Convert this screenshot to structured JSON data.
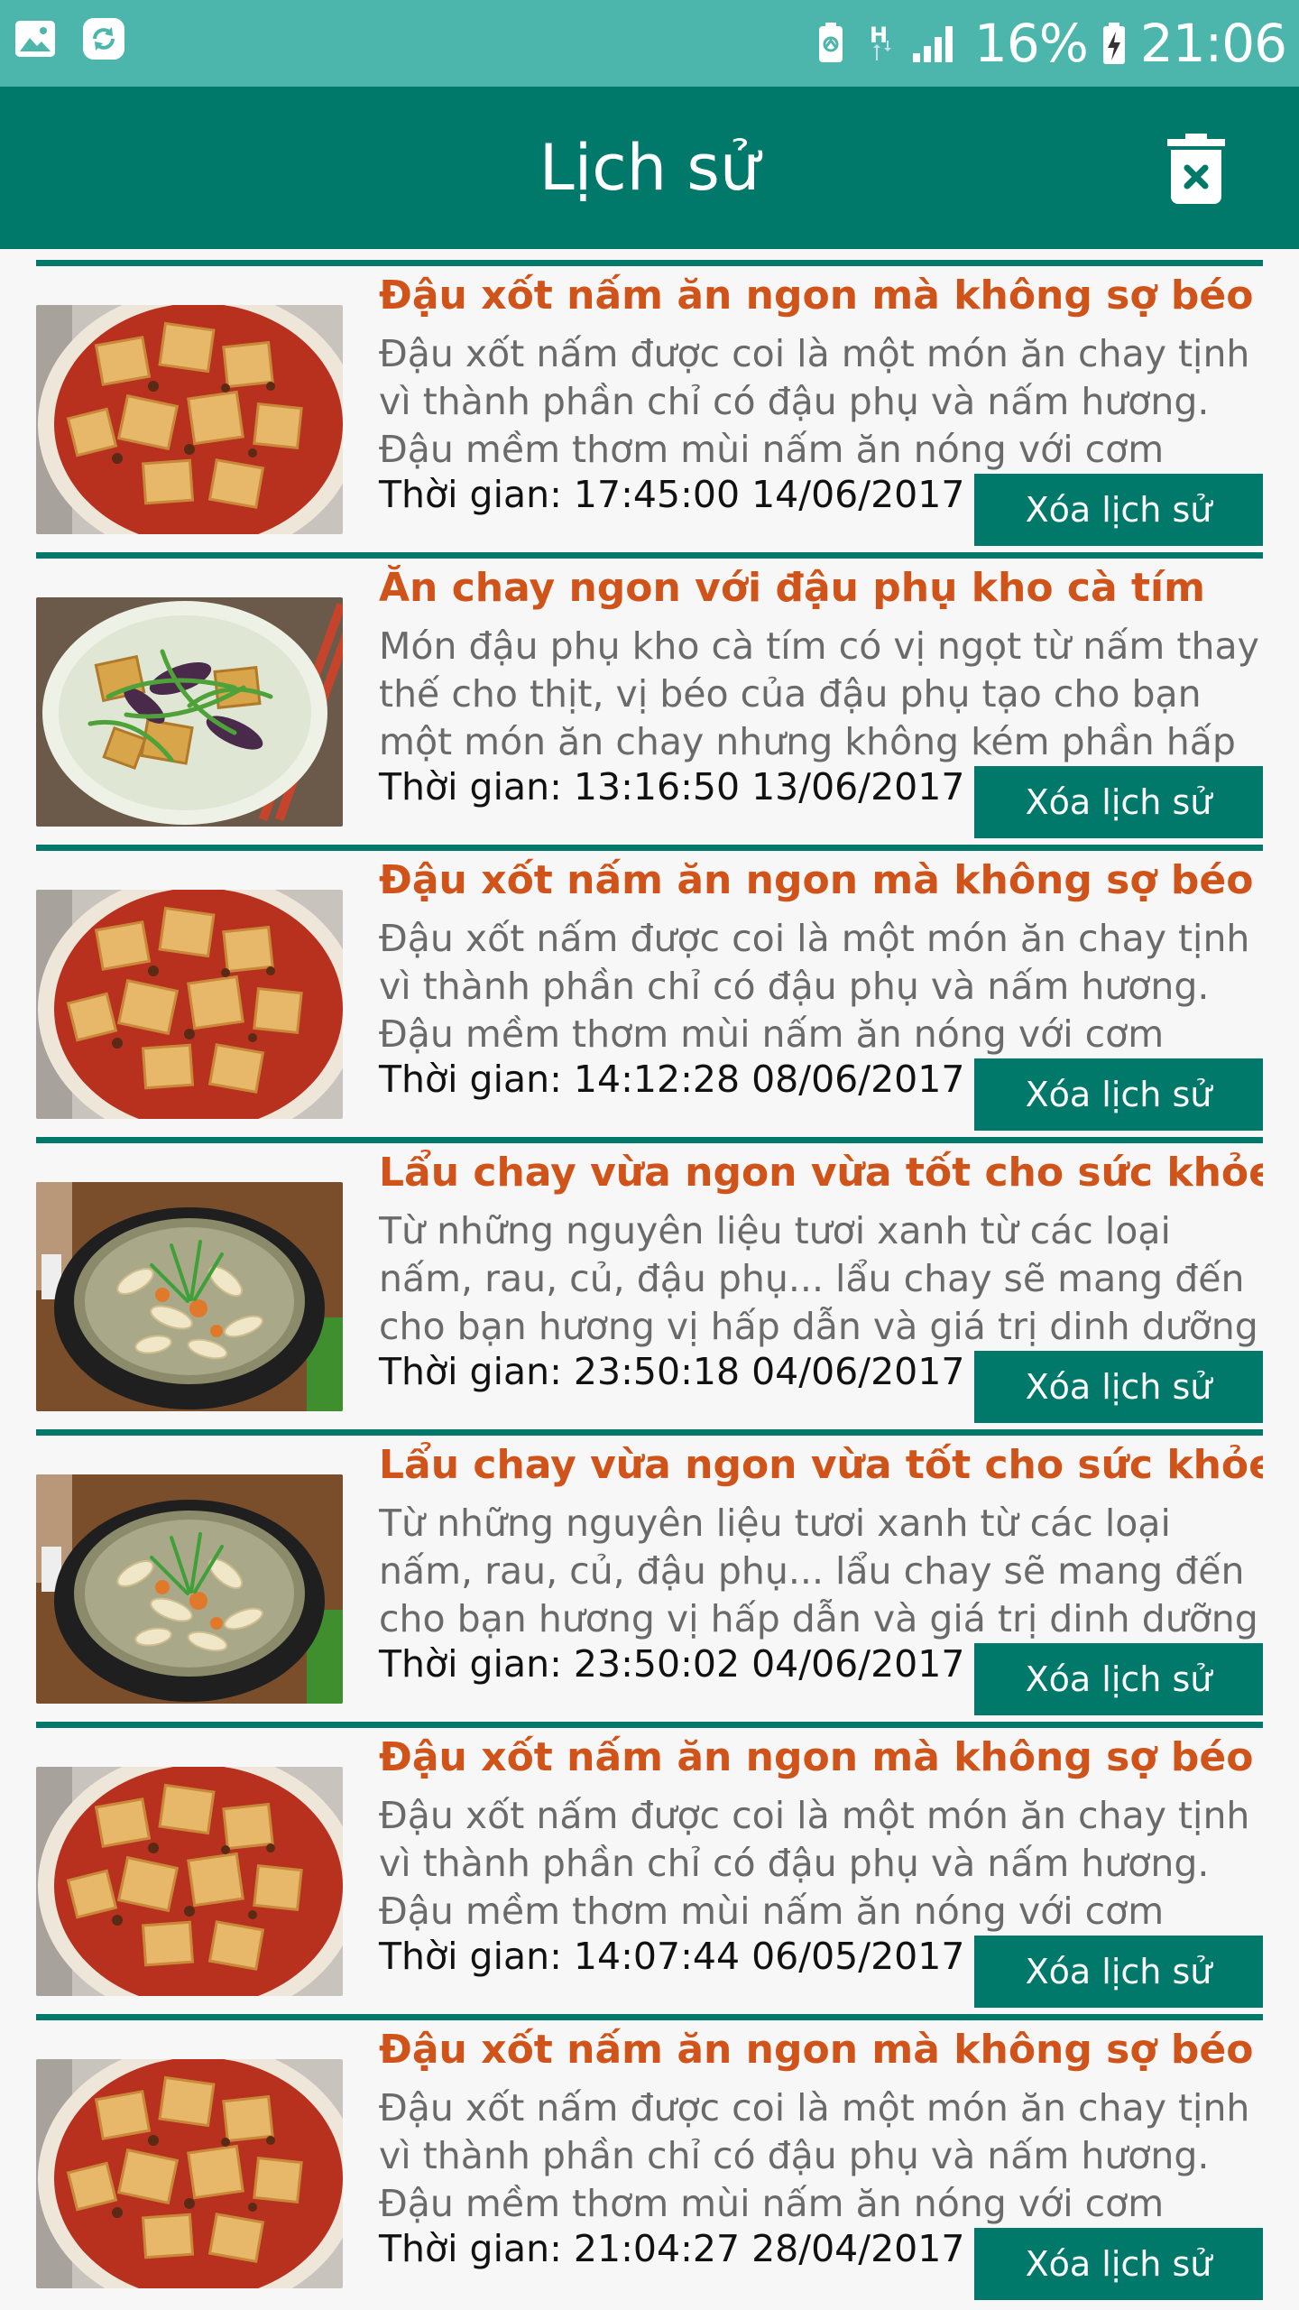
{
  "status_bar": {
    "battery": "16%",
    "time": "21:06",
    "icons": [
      "gallery-icon",
      "sync-icon",
      "battery-saver-icon",
      "hspa-icon",
      "signal-icon",
      "battery-charging-icon"
    ]
  },
  "app_bar": {
    "title": "Lịch sử",
    "clear_icon": "trash-clear-icon"
  },
  "colors": {
    "status_bar": "#4db6ac",
    "primary": "#00796b",
    "title_orange": "#d0531a"
  },
  "history": {
    "delete_label": "Xóa lịch sử",
    "time_prefix": "Thời gian: ",
    "items": [
      {
        "title": "Đậu xốt nấm ăn ngon mà không sợ béo",
        "description": "Đậu xốt nấm được coi là một món ăn chay tịnh vì thành phần chỉ có đậu phụ và nấm hương. Đậu mềm thơm mùi nấm ăn nóng với cơm trắng sẽ",
        "time": "17:45:00 14/06/2017",
        "image": "tofu-mushroom-image"
      },
      {
        "title": "Ăn chay ngon với đậu phụ kho cà tím",
        "description": "Món đậu phụ kho cà tím có vị ngọt từ nấm thay thế cho thịt, vị béo của đậu phụ tạo cho bạn một món ăn chay nhưng không kém phần hấp dẫn.",
        "time": "13:16:50 13/06/2017",
        "image": "tofu-eggplant-image"
      },
      {
        "title": "Đậu xốt nấm ăn ngon mà không sợ béo",
        "description": "Đậu xốt nấm được coi là một món ăn chay tịnh vì thành phần chỉ có đậu phụ và nấm hương. Đậu mềm thơm mùi nấm ăn nóng với cơm trắng sẽ",
        "time": "14:12:28 08/06/2017",
        "image": "tofu-mushroom-image"
      },
      {
        "title": "Lẩu chay vừa ngon vừa tốt cho sức khỏe",
        "description": "Từ những nguyên liệu tươi xanh từ các loại nấm, rau, củ, đậu phụ... lẩu chay sẽ mang đến cho bạn hương vị hấp dẫn và giá trị dinh dưỡng cao.",
        "time": "23:50:18 04/06/2017",
        "image": "vegetarian-hotpot-image"
      },
      {
        "title": "Lẩu chay vừa ngon vừa tốt cho sức khỏe",
        "description": "Từ những nguyên liệu tươi xanh từ các loại nấm, rau, củ, đậu phụ... lẩu chay sẽ mang đến cho bạn hương vị hấp dẫn và giá trị dinh dưỡng cao.",
        "time": "23:50:02 04/06/2017",
        "image": "vegetarian-hotpot-image"
      },
      {
        "title": "Đậu xốt nấm ăn ngon mà không sợ béo",
        "description": "Đậu xốt nấm được coi là một món ăn chay tịnh vì thành phần chỉ có đậu phụ và nấm hương. Đậu mềm thơm mùi nấm ăn nóng với cơm trắng sẽ",
        "time": "14:07:44 06/05/2017",
        "image": "tofu-mushroom-image"
      },
      {
        "title": "Đậu xốt nấm ăn ngon mà không sợ béo",
        "description": "Đậu xốt nấm được coi là một món ăn chay tịnh vì thành phần chỉ có đậu phụ và nấm hương. Đậu mềm thơm mùi nấm ăn nóng với cơm trắng sẽ",
        "time": "21:04:27 28/04/2017",
        "image": "tofu-mushroom-image"
      }
    ]
  }
}
